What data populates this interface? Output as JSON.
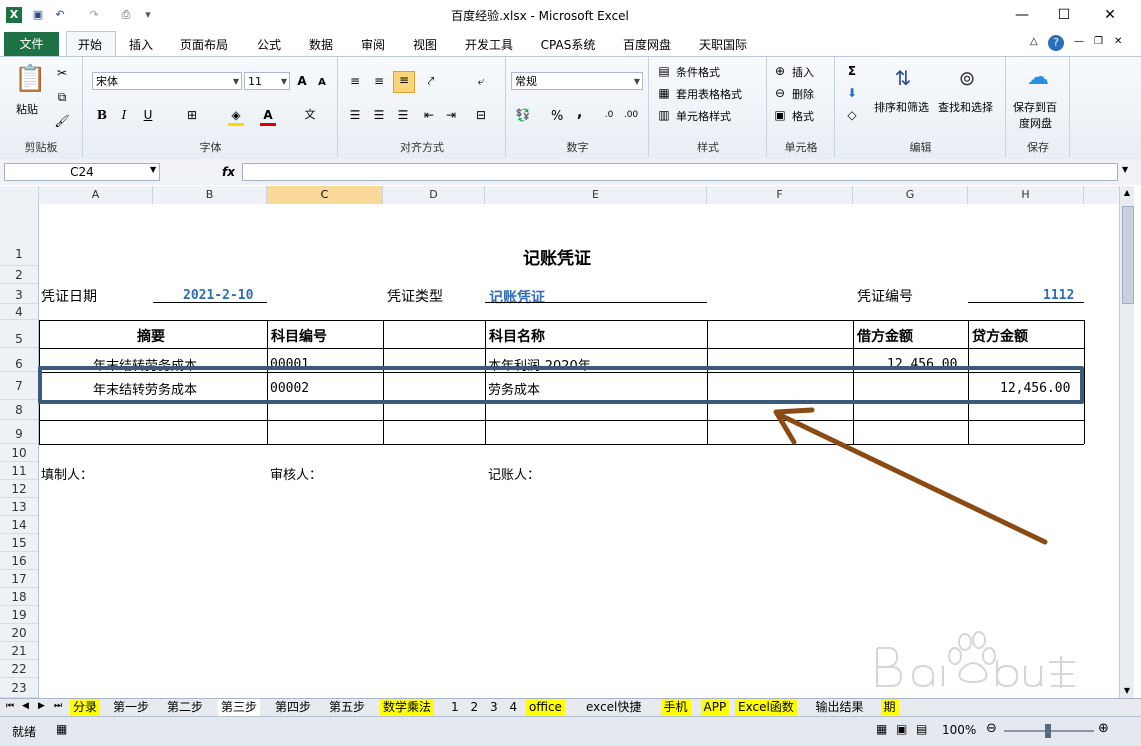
{
  "window": {
    "title": "百度经验.xlsx - Microsoft Excel",
    "controls": [
      "—",
      "☐",
      "✕"
    ]
  },
  "ribbon_tabs": [
    "文件",
    "开始",
    "插入",
    "页面布局",
    "公式",
    "数据",
    "审阅",
    "视图",
    "开发工具",
    "CPAS系统",
    "百度网盘",
    "天职国际"
  ],
  "ribbon": {
    "clipboard": {
      "paste": "粘贴",
      "group": "剪贴板"
    },
    "font": {
      "name": "宋体",
      "size": "11",
      "group": "字体"
    },
    "alignment": {
      "group": "对齐方式"
    },
    "number": {
      "format": "常规",
      "group": "数字",
      "percent": "%",
      "comma": ","
    },
    "styles": {
      "cond": "条件格式",
      "table": "套用表格格式",
      "cell": "单元格样式",
      "group": "样式"
    },
    "cells": {
      "insert": "插入",
      "delete": "删除",
      "format": "格式",
      "group": "单元格"
    },
    "editing": {
      "sort": "排序和筛选",
      "find": "查找和选择",
      "group": "编辑"
    },
    "save": {
      "line1": "保存到百",
      "line2": "度网盘",
      "group": "保存"
    }
  },
  "formula_bar": {
    "name_box": "C24",
    "fx": "fx",
    "value": ""
  },
  "columns": [
    "A",
    "B",
    "C",
    "D",
    "E",
    "F",
    "G",
    "H"
  ],
  "rows": [
    "1",
    "2",
    "3",
    "4",
    "5",
    "6",
    "7",
    "8",
    "9",
    "10",
    "11",
    "12",
    "13",
    "14",
    "15",
    "16",
    "17",
    "18",
    "19",
    "20",
    "21",
    "22",
    "23"
  ],
  "voucher": {
    "title": "记账凭证",
    "date_label": "凭证日期",
    "date_value": "2021-2-10",
    "type_label": "凭证类型",
    "type_value": "记账凭证",
    "number_label": "凭证编号",
    "number_value": "1112",
    "headers": {
      "summary": "摘要",
      "account_code": "科目编号",
      "account_name": "科目名称",
      "debit": "借方金额",
      "credit": "贷方金额"
    },
    "rows": [
      {
        "summary": "年末结转劳务成本",
        "code": "00001",
        "name": "本年利润-2020年",
        "debit": "12,456.00",
        "credit": ""
      },
      {
        "summary": "年末结转劳务成本",
        "code": "00002",
        "name": "劳务成本",
        "debit": "",
        "credit": "12,456.00"
      }
    ],
    "preparer": "填制人：",
    "reviewer": "审核人：",
    "bookkeeper": "记账人："
  },
  "sheet_tabs": [
    {
      "label": "分录",
      "highlight": "yellow"
    },
    {
      "label": "第一步",
      "highlight": "none"
    },
    {
      "label": "第二步",
      "highlight": "none"
    },
    {
      "label": "第三步",
      "highlight": "active"
    },
    {
      "label": "第四步",
      "highlight": "none"
    },
    {
      "label": "第五步",
      "highlight": "none"
    },
    {
      "label": "数学乘法",
      "highlight": "yellow"
    },
    {
      "label": "1",
      "highlight": "none"
    },
    {
      "label": "2",
      "highlight": "none"
    },
    {
      "label": "3",
      "highlight": "none"
    },
    {
      "label": "4",
      "highlight": "none"
    },
    {
      "label": "office",
      "highlight": "yellow"
    },
    {
      "label": "excel快捷",
      "highlight": "none"
    },
    {
      "label": "手机",
      "highlight": "yellow"
    },
    {
      "label": "APP",
      "highlight": "yellow"
    },
    {
      "label": "Excel函数",
      "highlight": "yellow"
    },
    {
      "label": "输出结果",
      "highlight": "none"
    },
    {
      "label": "期",
      "highlight": "yellow"
    }
  ],
  "status": {
    "ready": "就绪",
    "zoom": "100%"
  },
  "colors": {
    "file_tab": "#1e7145",
    "highlight_box": "#3b5a7e",
    "arrow": "#8b4a14",
    "selected_col": "#f9d99a"
  }
}
